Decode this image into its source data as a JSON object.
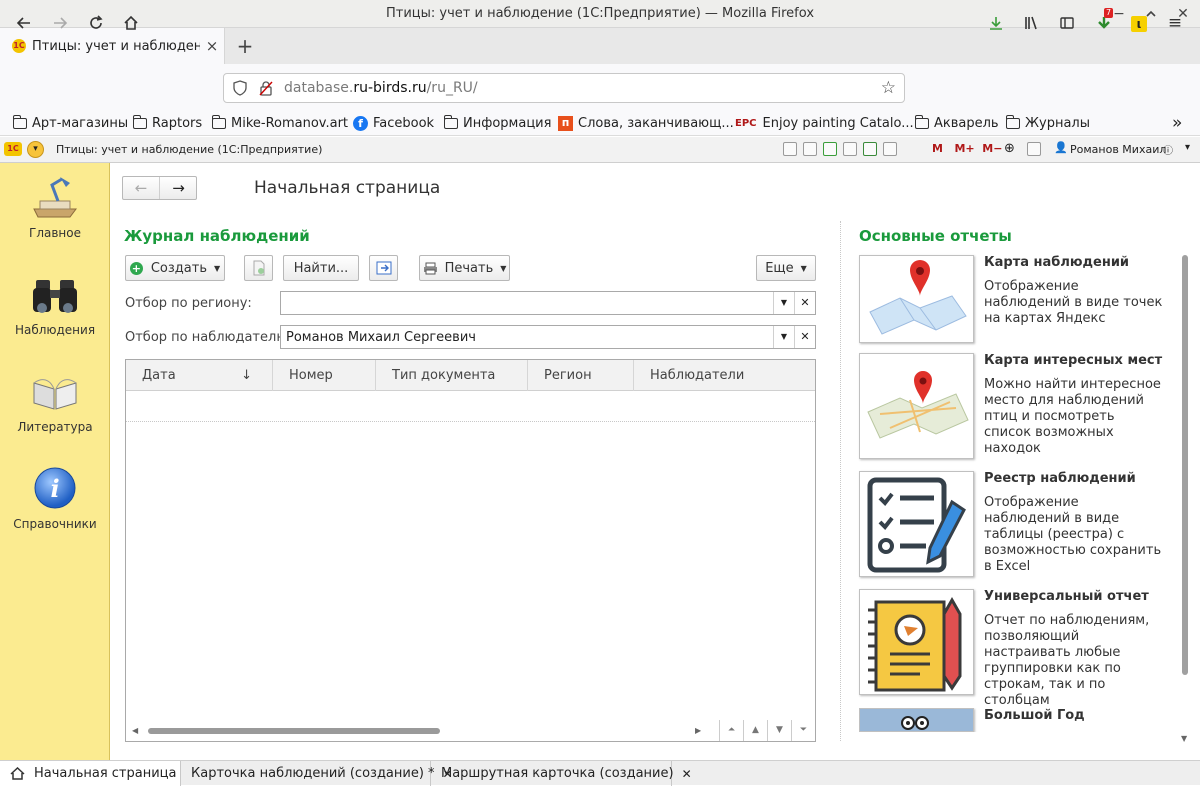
{
  "window": {
    "title": "Птицы: учет и наблюдение (1С:Предприятие) — Mozilla Firefox"
  },
  "browser_tab": {
    "label": "Птицы: учет и наблюдение (1С:Предприятие)",
    "close": "×",
    "new_tab": "+"
  },
  "url": {
    "prefix": "database.",
    "host": "ru-birds.ru",
    "path": "/ru_RU/"
  },
  "extension_badge": "7",
  "bookmarks": [
    "Арт-магазины",
    "Raptors",
    "Mike-Romanov.art",
    "Facebook",
    "Информация",
    "Слова, заканчивающ...",
    "Enjoy painting Catalo...",
    "Акварель",
    "Журналы"
  ],
  "bookmark_icons": {
    "facebook": "f",
    "slova": "п",
    "epc": "EPC"
  },
  "app": {
    "logo_text": "1С",
    "title": "Птицы: учет и наблюдение  (1С:Предприятие)",
    "user": "Романов Михаил",
    "toolbar_marks": [
      "M",
      "M+",
      "M−"
    ]
  },
  "sidebar": {
    "items": [
      "Главное",
      "Наблюдения",
      "Литература",
      "Справочники"
    ]
  },
  "page": {
    "title": "Начальная страница",
    "back_icon": "←",
    "forward_icon": "→"
  },
  "journal": {
    "heading": "Журнал наблюдений",
    "create_label": "Создать",
    "find_label": "Найти...",
    "print_label": "Печать",
    "more_label": "Еще",
    "region_filter_label": "Отбор по региону:",
    "region_filter_value": "",
    "observer_filter_label": "Отбор по наблюдателю:",
    "observer_filter_value": "Романов Михаил Сергеевич",
    "columns": [
      "Дата",
      "Номер",
      "Тип документа",
      "Регион",
      "Наблюдатели"
    ],
    "sort_icon": "↓"
  },
  "reports": {
    "heading": "Основные отчеты",
    "items": [
      {
        "title": "Карта наблюдений",
        "desc": "Отображение наблюдений в виде точек на картах Яндекс"
      },
      {
        "title": "Карта интересных мест",
        "desc": "Можно найти интересное место для наблюдений птиц и посмотреть список возможных находок"
      },
      {
        "title": "Реестр наблюдений",
        "desc": "Отображение наблюдений в виде таблицы (реестра) с возможностью сохранить в Excel"
      },
      {
        "title": "Универсальный отчет",
        "desc": "Отчет по наблюдениям, позволяющий настраивать любые группировки как по строкам, так и по столбцам"
      },
      {
        "title": "Большой Год",
        "desc": ""
      }
    ]
  },
  "bottom_tabs": [
    "Начальная страница",
    "Карточка наблюдений (создание) *",
    "Маршрутная карточка (создание)"
  ],
  "colors": {
    "accent_green": "#1a9a3c",
    "sidebar_yellow": "#fbeb90"
  }
}
